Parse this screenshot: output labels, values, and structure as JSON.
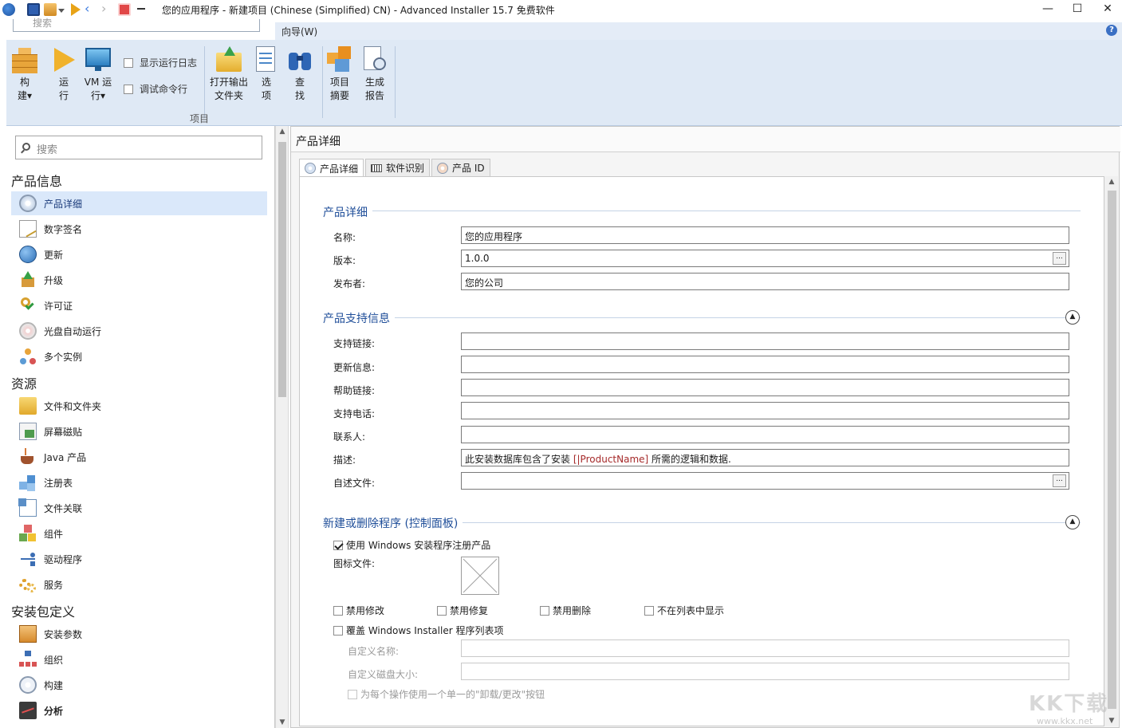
{
  "window": {
    "title": "您的应用程序 - 新建项目 (Chinese (Simplified) CN) - Advanced Installer 15.7 免费软件",
    "minimize": "—",
    "maximize": "☐",
    "close": "✕"
  },
  "ribbon": {
    "menu_label": "向导(W)",
    "search_placeholder": "搜索",
    "help_label": "?",
    "buttons": {
      "build": "构\n建▾",
      "run": "运\n行",
      "vm_run": "VM 运\n行▾",
      "open_output": "打开输出\n文件夹",
      "options": "选\n项",
      "find": "查\n找",
      "project_summary": "项目\n摘要",
      "generate_report": "生成\n报告"
    },
    "checks": {
      "show_log": "显示运行日志",
      "debug_cmd": "调试命令行"
    },
    "group_label": "项目"
  },
  "left": {
    "search_placeholder": "搜索",
    "sections": {
      "product_info": "产品信息",
      "resources": "资源",
      "package_def": "安装包定义"
    },
    "items": {
      "product_details": "产品详细",
      "digital_signature": "数字签名",
      "updates": "更新",
      "upgrade": "升级",
      "license": "许可证",
      "autorun": "光盘自动运行",
      "multi_instance": "多个实例",
      "files_folders": "文件和文件夹",
      "shortcuts": "屏幕磁贴",
      "java": "Java 产品",
      "registry": "注册表",
      "file_assoc": "文件关联",
      "components": "组件",
      "drivers": "驱动程序",
      "services": "服务",
      "install_params": "安装参数",
      "organization": "组织",
      "build": "构建",
      "analysis": "分析"
    }
  },
  "right": {
    "header_title": "产品详细",
    "tabs": {
      "details": "产品详细",
      "software_id": "软件识别",
      "product_id": "产品 ID"
    },
    "groups": {
      "details": "产品详细",
      "support": "产品支持信息",
      "addremove": "新建或删除程序 (控制面板)"
    },
    "fields": {
      "name_label": "名称:",
      "name_value": "您的应用程序",
      "version_label": "版本:",
      "version_value": "1.0.0",
      "publisher_label": "发布者:",
      "publisher_value": "您的公司",
      "support_link_label": "支持链接:",
      "update_info_label": "更新信息:",
      "help_link_label": "帮助链接:",
      "support_phone_label": "支持电话:",
      "contact_label": "联系人:",
      "description_label": "描述:",
      "description_prefix": "此安装数据库包含了安装 ",
      "description_token": "[|ProductName]",
      "description_suffix": " 所需的逻辑和数据.",
      "readme_label": "自述文件:",
      "icon_file_label": "图标文件:",
      "custom_name_label": "自定义名称:",
      "custom_disk_label": "自定义磁盘大小:"
    },
    "checks": {
      "use_windows_register": "使用 Windows 安装程序注册产品",
      "disable_modify": "禁用修改",
      "disable_repair": "禁用修复",
      "disable_remove": "禁用删除",
      "hide_in_list": "不在列表中显示",
      "override_entry": "覆盖 Windows Installer 程序列表项",
      "single_button": "为每个操作使用一个单一的\"卸载/更改\"按钮"
    }
  },
  "watermark": {
    "text": "KK下载",
    "url": "www.kkx.net"
  },
  "colors": {
    "accent": "#1f4e99",
    "ribbon": "#dfe9f5",
    "selection": "#dae8fa"
  }
}
